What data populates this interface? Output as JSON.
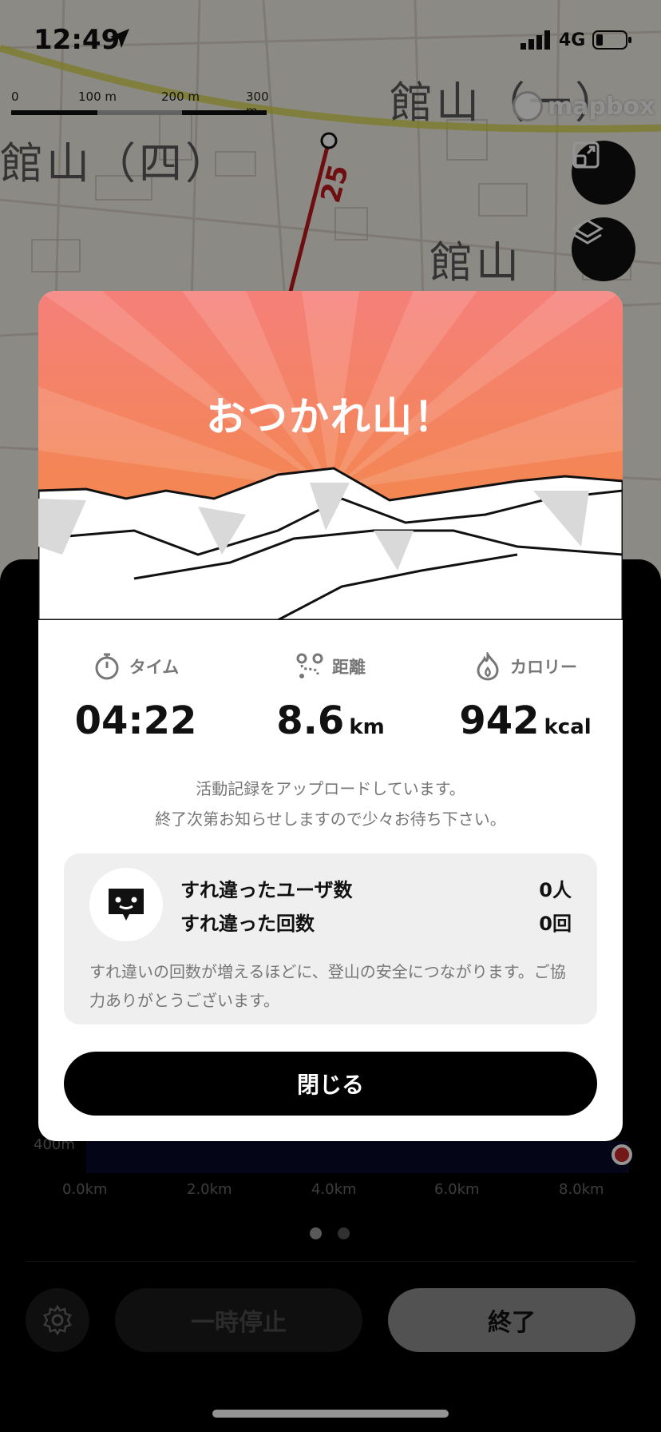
{
  "status_bar": {
    "time": "12:49",
    "network": "4G"
  },
  "map": {
    "scale_labels": [
      "0",
      "100 m",
      "200 m",
      "300 m"
    ],
    "attribution": "mapbox",
    "place_labels": [
      "館山（四）",
      "館山（一）",
      "館山"
    ],
    "route_marker": "25",
    "buttons": [
      "fullscreen-icon",
      "layers-icon"
    ]
  },
  "modal": {
    "title": "おつかれ山！",
    "stats": [
      {
        "icon": "stopwatch-icon",
        "label": "タイム",
        "value": "04:22",
        "unit": ""
      },
      {
        "icon": "route-icon",
        "label": "距離",
        "value": "8.6",
        "unit": "km"
      },
      {
        "icon": "flame-icon",
        "label": "カロリー",
        "value": "942",
        "unit": "kcal"
      }
    ],
    "upload_line1": "活動記録をアップロードしています。",
    "upload_line2": "終了次第お知らせしますので少々お待ち下さい。",
    "encounter": {
      "users_label": "すれ違ったユーザ数",
      "users_value": "0人",
      "count_label": "すれ違った回数",
      "count_value": "0回",
      "note": "すれ違いの回数が増えるほどに、登山の安全につながります。ご協力ありがとうございます。"
    },
    "close_label": "閉じる"
  },
  "sheet": {
    "y_labels": [
      "400m"
    ],
    "x_labels": [
      "0.0km",
      "2.0km",
      "4.0km",
      "6.0km",
      "8.0km"
    ],
    "pause_label": "一時停止",
    "end_label": "終了"
  },
  "colors": {
    "hero_top": "#f5807a",
    "hero_bottom": "#f28a3a",
    "route": "#c0191e",
    "button_dark": "#000000"
  }
}
